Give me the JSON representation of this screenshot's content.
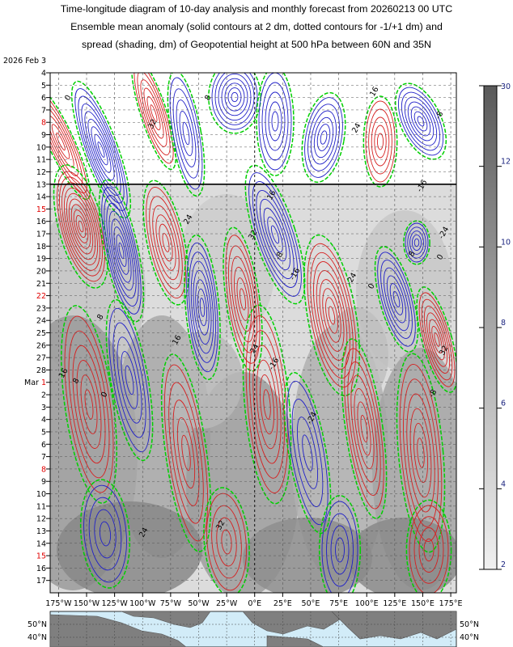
{
  "title_lines": [
    "Time-longitude diagram of 10-day analysis and monthly forecast from 20260213 00 UTC",
    "Ensemble mean anomaly (solid contours at 2 dm, dotted contours for -1/+1 dm) and",
    "spread (shading, dm) of Geopotential height at 500 hPa between 60N and 35N"
  ],
  "chart_data": {
    "type": "heatmap",
    "description_units": "dm",
    "x_ticks": [
      "175°W",
      "150°W",
      "125°W",
      "100°W",
      "75°W",
      "50°W",
      "25°W",
      "0°E",
      "25°E",
      "50°E",
      "75°E",
      "100°E",
      "125°E",
      "150°E",
      "175°E"
    ],
    "y_month_labels": [
      {
        "label": "2026 Feb",
        "day_index": 0
      },
      {
        "label": "Mar",
        "day_index": 26
      }
    ],
    "y_days": [
      "3",
      "4",
      "5",
      "6",
      "7",
      "8",
      "9",
      "10",
      "11",
      "12",
      "13",
      "14",
      "15",
      "16",
      "17",
      "18",
      "19",
      "20",
      "21",
      "22",
      "23",
      "24",
      "25",
      "26",
      "27",
      "28",
      "1",
      "2",
      "3",
      "4",
      "5",
      "6",
      "7",
      "8",
      "9",
      "10",
      "11",
      "12",
      "13",
      "14",
      "15",
      "16",
      "17"
    ],
    "y_red_labels": [
      "8",
      "15",
      "22",
      "1",
      "8",
      "15"
    ],
    "analysis_forecast_divider_day": "13",
    "colorbar": {
      "ticks": [
        "2",
        "4",
        "6",
        "8",
        "10",
        "12",
        "30"
      ],
      "values": [
        2,
        4,
        6,
        8,
        10,
        12,
        30
      ]
    },
    "contour_labels": [
      "0",
      "8",
      "16",
      "24",
      "32",
      "-8",
      "-16",
      "-24"
    ],
    "map_strip": {
      "lat_labels": [
        "50°N",
        "40°N"
      ]
    },
    "colors": {
      "positive": "#d62020",
      "negative": "#2020c8",
      "zero": "#00d000",
      "shade_light": "#e6e6e6",
      "shade_dark": "#7a7a7a"
    }
  }
}
